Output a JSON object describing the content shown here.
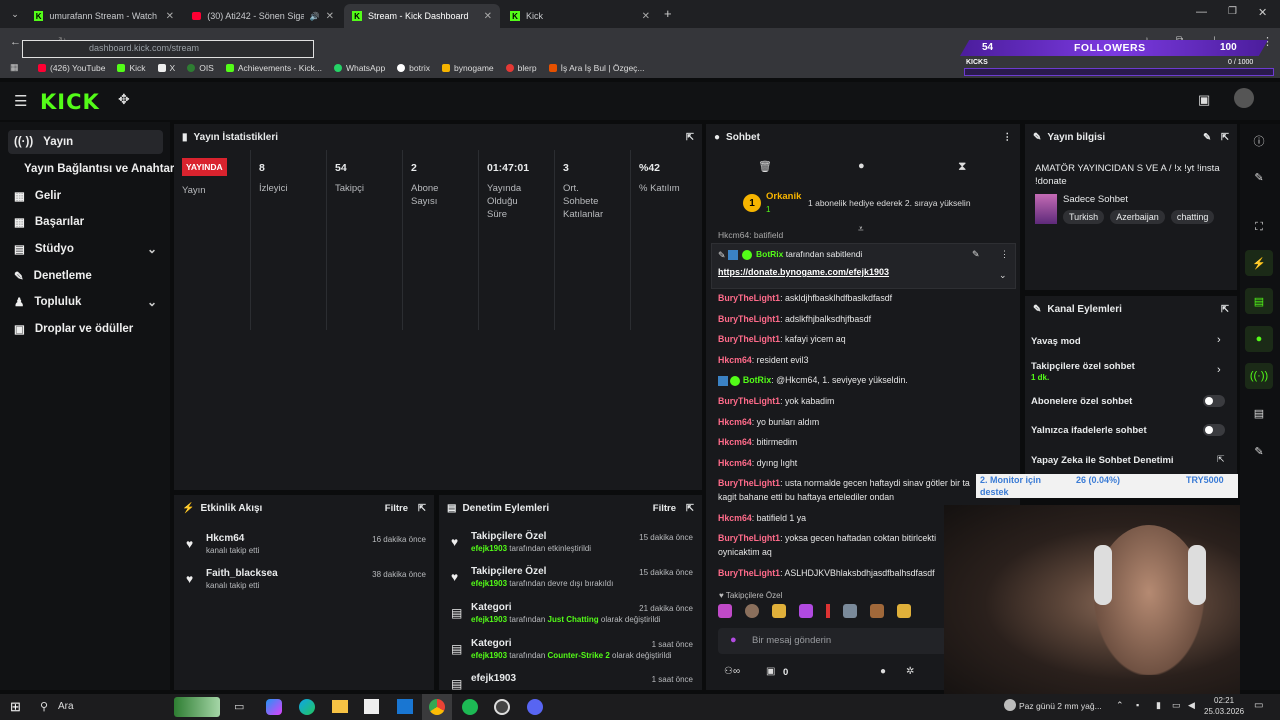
{
  "browser": {
    "tabs": [
      {
        "label": "umurafann Stream - Watch Live"
      },
      {
        "label": "(30) Ati242 - Sönen Sigaralar"
      },
      {
        "label": "Stream - Kick Dashboard"
      },
      {
        "label": "Kick"
      }
    ],
    "url": "dashboard.kick.com/stream",
    "bookmarks": [
      "(426) YouTube",
      "Kick",
      "X",
      "OIS",
      "Achievements - Kick...",
      "WhatsApp",
      "botrix",
      "bynogame",
      "blerp",
      "İş Ara İş Bul | Özgeç..."
    ]
  },
  "overlay": {
    "followers_count": "54",
    "followers_label": "FOLLOWERS",
    "goal": "100",
    "kicks_label": "KICKS",
    "kicks_progress": "0 / 1000"
  },
  "sidebar": {
    "items": [
      {
        "label": "Yayın"
      },
      {
        "label": "Yayın Bağlantısı ve Anahtarı"
      },
      {
        "label": "Gelir"
      },
      {
        "label": "Başarılar"
      },
      {
        "label": "Stüdyo"
      },
      {
        "label": "Denetleme"
      },
      {
        "label": "Topluluk"
      },
      {
        "label": "Droplar ve ödüller"
      }
    ]
  },
  "stats": {
    "title": "Yayın İstatistikleri",
    "live_badge": "YAYINDA",
    "live_label": "Yayın",
    "items": [
      {
        "value": "8",
        "label": "İzleyici"
      },
      {
        "value": "54",
        "label": "Takipçi"
      },
      {
        "value": "2",
        "label": "Abone Sayısı"
      },
      {
        "value": "01:47:01",
        "label": "Yayında Olduğu Süre"
      },
      {
        "value": "3",
        "label": "Ort. Sohbete Katılanlar"
      },
      {
        "value": "%42",
        "label": "% Katılım"
      }
    ]
  },
  "activity": {
    "title": "Etkinlik Akışı",
    "filter": "Filtre",
    "items": [
      {
        "user": "Hkcm64",
        "action": "kanalı takip etti",
        "time": "16 dakika önce"
      },
      {
        "user": "Faith_blacksea",
        "action": "kanalı takip etti",
        "time": "38 dakika önce"
      }
    ]
  },
  "moderation": {
    "title": "Denetim Eylemleri",
    "filter": "Filtre",
    "items": [
      {
        "title": "Takipçilere Özel",
        "user": "efejk1903",
        "pre": "tarafından etkinleştirildi",
        "highlight": "",
        "post": "",
        "time": "15 dakika önce"
      },
      {
        "title": "Takipçilere Özel",
        "user": "efejk1903",
        "pre": "tarafından devre dışı bırakıldı",
        "highlight": "",
        "post": "",
        "time": "15 dakika önce"
      },
      {
        "title": "Kategori",
        "user": "efejk1903",
        "pre": "tarafından",
        "highlight": "Just Chatting",
        "post": "olarak değiştirildi",
        "time": "21 dakika önce"
      },
      {
        "title": "Kategori",
        "user": "efejk1903",
        "pre": "tarafından",
        "highlight": "Counter-Strike 2",
        "post": "olarak değiştirildi",
        "time": "1 saat önce"
      },
      {
        "title": "efejk1903",
        "user": "",
        "pre": "",
        "highlight": "",
        "post": "",
        "time": "1 saat önce"
      }
    ]
  },
  "chat": {
    "title": "Sohbet",
    "gift_user": "Orkanik",
    "gift_rank": "1",
    "gift_count": "1",
    "gift_text": "1 abonelik hediye ederek 2. sıraya yükselin",
    "pinned_by": "BotRix",
    "pinned_label": "tarafından sabitlendi",
    "pinned_link": "https://donate.bynogame.com/efejk1903",
    "partial": "Hkcm64: batifield",
    "messages": [
      {
        "user": "BuryTheLight1",
        "text": ": askldjhfbasklhdfbaslkdfasdf"
      },
      {
        "user": "BuryTheLight1",
        "text": ": adslkfhjbalksdhjfbasdf"
      },
      {
        "user": "BuryTheLight1",
        "text": ": kafayi yicem aq"
      },
      {
        "user": "Hkcm64",
        "text": ": resident evil3"
      },
      {
        "user": "BotRix",
        "text": ": @Hkcm64, 1. seviyeye yükseldin.",
        "bot": true
      },
      {
        "user": "BuryTheLight1",
        "text": ": yok kabadim"
      },
      {
        "user": "Hkcm64",
        "text": ": yo bunları aldım"
      },
      {
        "user": "Hkcm64",
        "text": ": bitirmedim"
      },
      {
        "user": "Hkcm64",
        "text": ": dyıng lıght"
      },
      {
        "user": "BuryTheLight1",
        "text": ": usta normalde gecen haftaydi sinav götler bir ta",
        "cont": "kagit bahane etti bu haftaya ertelediler ondan"
      },
      {
        "user": "Hkcm64",
        "text": ": batifield 1 ya"
      },
      {
        "user": "BuryTheLight1",
        "text": ": yoksa gecen haftadan coktan bitirlcekti",
        "cont": "oynicaktim aq"
      },
      {
        "user": "BuryTheLight1",
        "text": ": ASLHDJKVBhlaksbdhjasdfbalhsdfasdf"
      }
    ],
    "mode_label": "Takipçilere Özel",
    "input_placeholder": "Bir mesaj gönderin",
    "points": "0"
  },
  "stream_info": {
    "title": "Yayın bilgisi",
    "stream_title": "AMATÖR YAYINCIDAN S VE A / !x !yt !insta !donate",
    "category": "Sadece Sohbet",
    "tags": [
      "Turkish",
      "Azerbaijan",
      "chatting"
    ]
  },
  "channel_actions": {
    "title": "Kanal Eylemleri",
    "slow_mode": "Yavaş mod",
    "followers_only": "Takipçilere özel sohbet",
    "followers_only_sub": "1 dk.",
    "subs_only": "Abonelere özel sohbet",
    "emote_only": "Yalnızca ifadelerle sohbet",
    "ai_mod": "Yapay Zeka ile Sohbet Denetimi"
  },
  "donation_overlay": {
    "line1": "2. Monitor için",
    "amount": "26 (0.04%)",
    "goal": "TRY5000",
    "line2": "destek"
  },
  "taskbar": {
    "search": "Ara",
    "weather": "Paz günü 2 mm yağ...",
    "time": "02:21",
    "date": "25.03.2026"
  }
}
